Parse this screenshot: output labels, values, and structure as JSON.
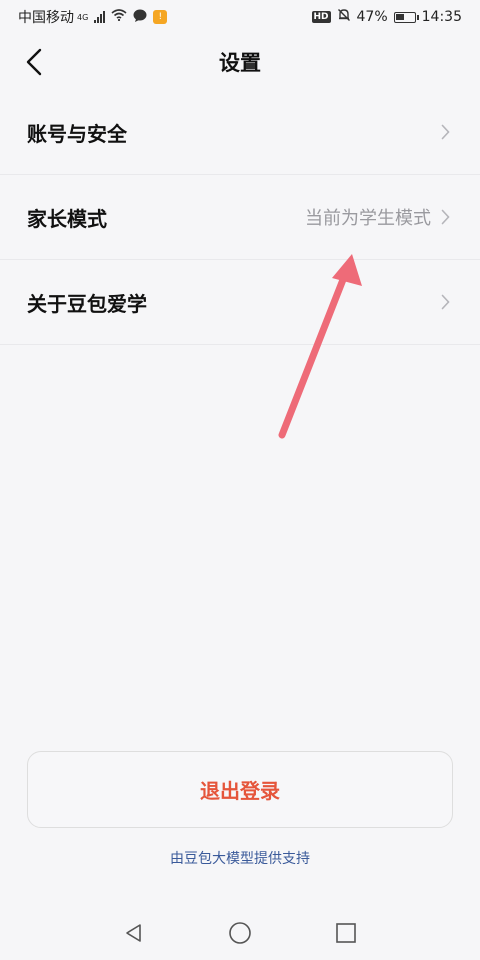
{
  "status_bar": {
    "carrier": "中国移动",
    "network": "4G",
    "hd": "HD",
    "battery": "47%",
    "battery_level": 0.47,
    "time": "14:35"
  },
  "header": {
    "title": "设置",
    "back_icon": "chevron-left-icon"
  },
  "menu": {
    "items": [
      {
        "label": "账号与安全",
        "value": ""
      },
      {
        "label": "家长模式",
        "value": "当前为学生模式"
      },
      {
        "label": "关于豆包爱学",
        "value": ""
      }
    ]
  },
  "actions": {
    "logout_label": "退出登录"
  },
  "footer": {
    "powered_by": "由豆包大模型提供支持"
  },
  "colors": {
    "accent_red": "#e5553b",
    "link_blue": "#3a5a9a",
    "annotation_arrow": "#ee6b78"
  },
  "system_nav": {
    "icons": [
      "back-triangle-icon",
      "home-circle-icon",
      "recents-square-icon"
    ]
  }
}
